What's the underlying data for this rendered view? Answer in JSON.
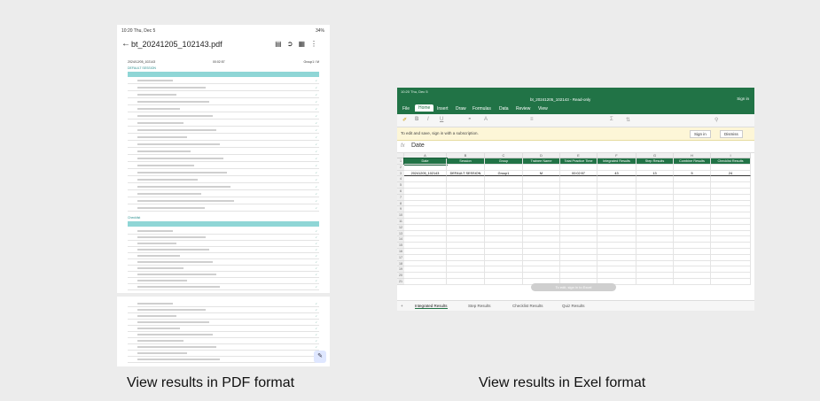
{
  "captions": {
    "pdf": "View results in PDF format",
    "excel": "View results in Exel format"
  },
  "pdf": {
    "status_time": "10:20  Thu, Dec 5",
    "status_battery": "34%",
    "filename": "bt_20241205_102143.pdf",
    "meta_date": "2024/12/05_102143",
    "meta_time": "00:02:57",
    "meta_group": "Group1 / M",
    "section1": "DEFAULT SESSION",
    "section2": "Checklist",
    "icons": [
      "back-icon",
      "document-icon",
      "share-icon",
      "grid-icon",
      "more-icon",
      "edit-icon"
    ]
  },
  "excel": {
    "status_time": "10:20  Thu, Dec 5",
    "title": "bt_20241205_102143 - Read-only",
    "sign_in_top": "Sign in",
    "tabs": [
      "File",
      "Home",
      "Insert",
      "Draw",
      "Formulas",
      "Data",
      "Review",
      "View"
    ],
    "active_tab": "Home",
    "message": "To edit and save, sign in with a subscription.",
    "sign_in_btn": "Sign in",
    "dismiss_btn": "Dismiss",
    "formula_label": "fx",
    "formula_value": "Date",
    "columns": [
      "A",
      "B",
      "C",
      "D",
      "E",
      "F",
      "G",
      "H",
      "I"
    ],
    "headers": [
      "Date",
      "Session",
      "Group",
      "Trainee Name",
      "Total Practice Time",
      "Integrated Results",
      "Step Results",
      "Combine Results",
      "Checklist Results"
    ],
    "data_row": [
      "20241205_102143",
      "DEFAULT SESSION",
      "Group1",
      "M",
      "00:02:57",
      "43",
      "13",
      "5",
      "24"
    ],
    "row_numbers": [
      "1",
      "2",
      "3",
      "4",
      "5",
      "6",
      "7",
      "8",
      "9",
      "10",
      "11",
      "12",
      "13",
      "14",
      "15",
      "16",
      "17",
      "18",
      "19",
      "20",
      "21"
    ],
    "sheets": [
      "Integrated Results",
      "Step Results",
      "Checklist Results",
      "Quiz Results"
    ],
    "active_sheet": "Integrated Results",
    "toast": "To edit, sign in to Excel"
  }
}
